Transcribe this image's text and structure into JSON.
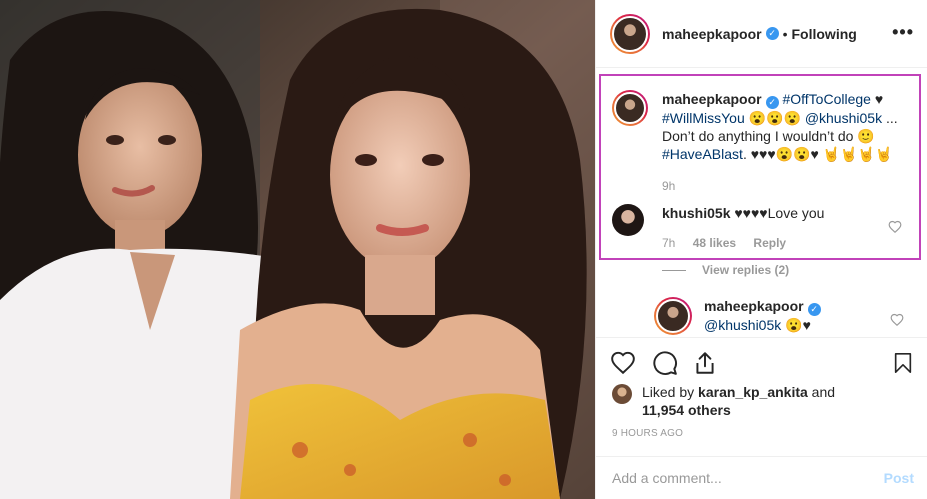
{
  "post": {
    "author": "maheepkapoor",
    "follow_status": "Following",
    "dot": "•",
    "more": "•••"
  },
  "caption": {
    "username": "maheepkapoor",
    "text_1": " ",
    "hashtag_1": "#OffToCollege",
    "text_2": " ♥ ",
    "hashtag_2": "#WillMissYou",
    "text_3": " 😮😮😮 ",
    "mention_1": "@khushi05k",
    "text_4": " ... Don’t do anything I wouldn’t do 🙂 ",
    "hashtag_3": "#HaveABlast",
    "text_5": ". ♥♥♥😮😮♥ 🤘🤘🤘🤘",
    "time": "9h"
  },
  "reply_comment": {
    "username": "khushi05k",
    "text": " ♥♥♥♥Love you",
    "time": "7h",
    "likes": "48 likes",
    "reply": "Reply"
  },
  "view_replies": "View replies (2)",
  "nested_reply": {
    "username": "maheepkapoor",
    "mention": "@khushi05k",
    "text": " 😮♥"
  },
  "likes": {
    "prefix": "Liked by ",
    "user": "karan_kp_ankita",
    "middle": " and",
    "count": "11,954 others"
  },
  "timestamp": "9 HOURS AGO",
  "add_comment": {
    "placeholder": "Add a comment...",
    "post": "Post"
  },
  "icons": {
    "like": "heart-icon",
    "comment": "comment-icon",
    "share": "share-icon",
    "save": "bookmark-icon",
    "more": "more-options-icon"
  },
  "colors": {
    "highlight": "#c142b9",
    "link": "#003569",
    "verified": "#3897f0",
    "post_disabled": "#b3dbff"
  }
}
